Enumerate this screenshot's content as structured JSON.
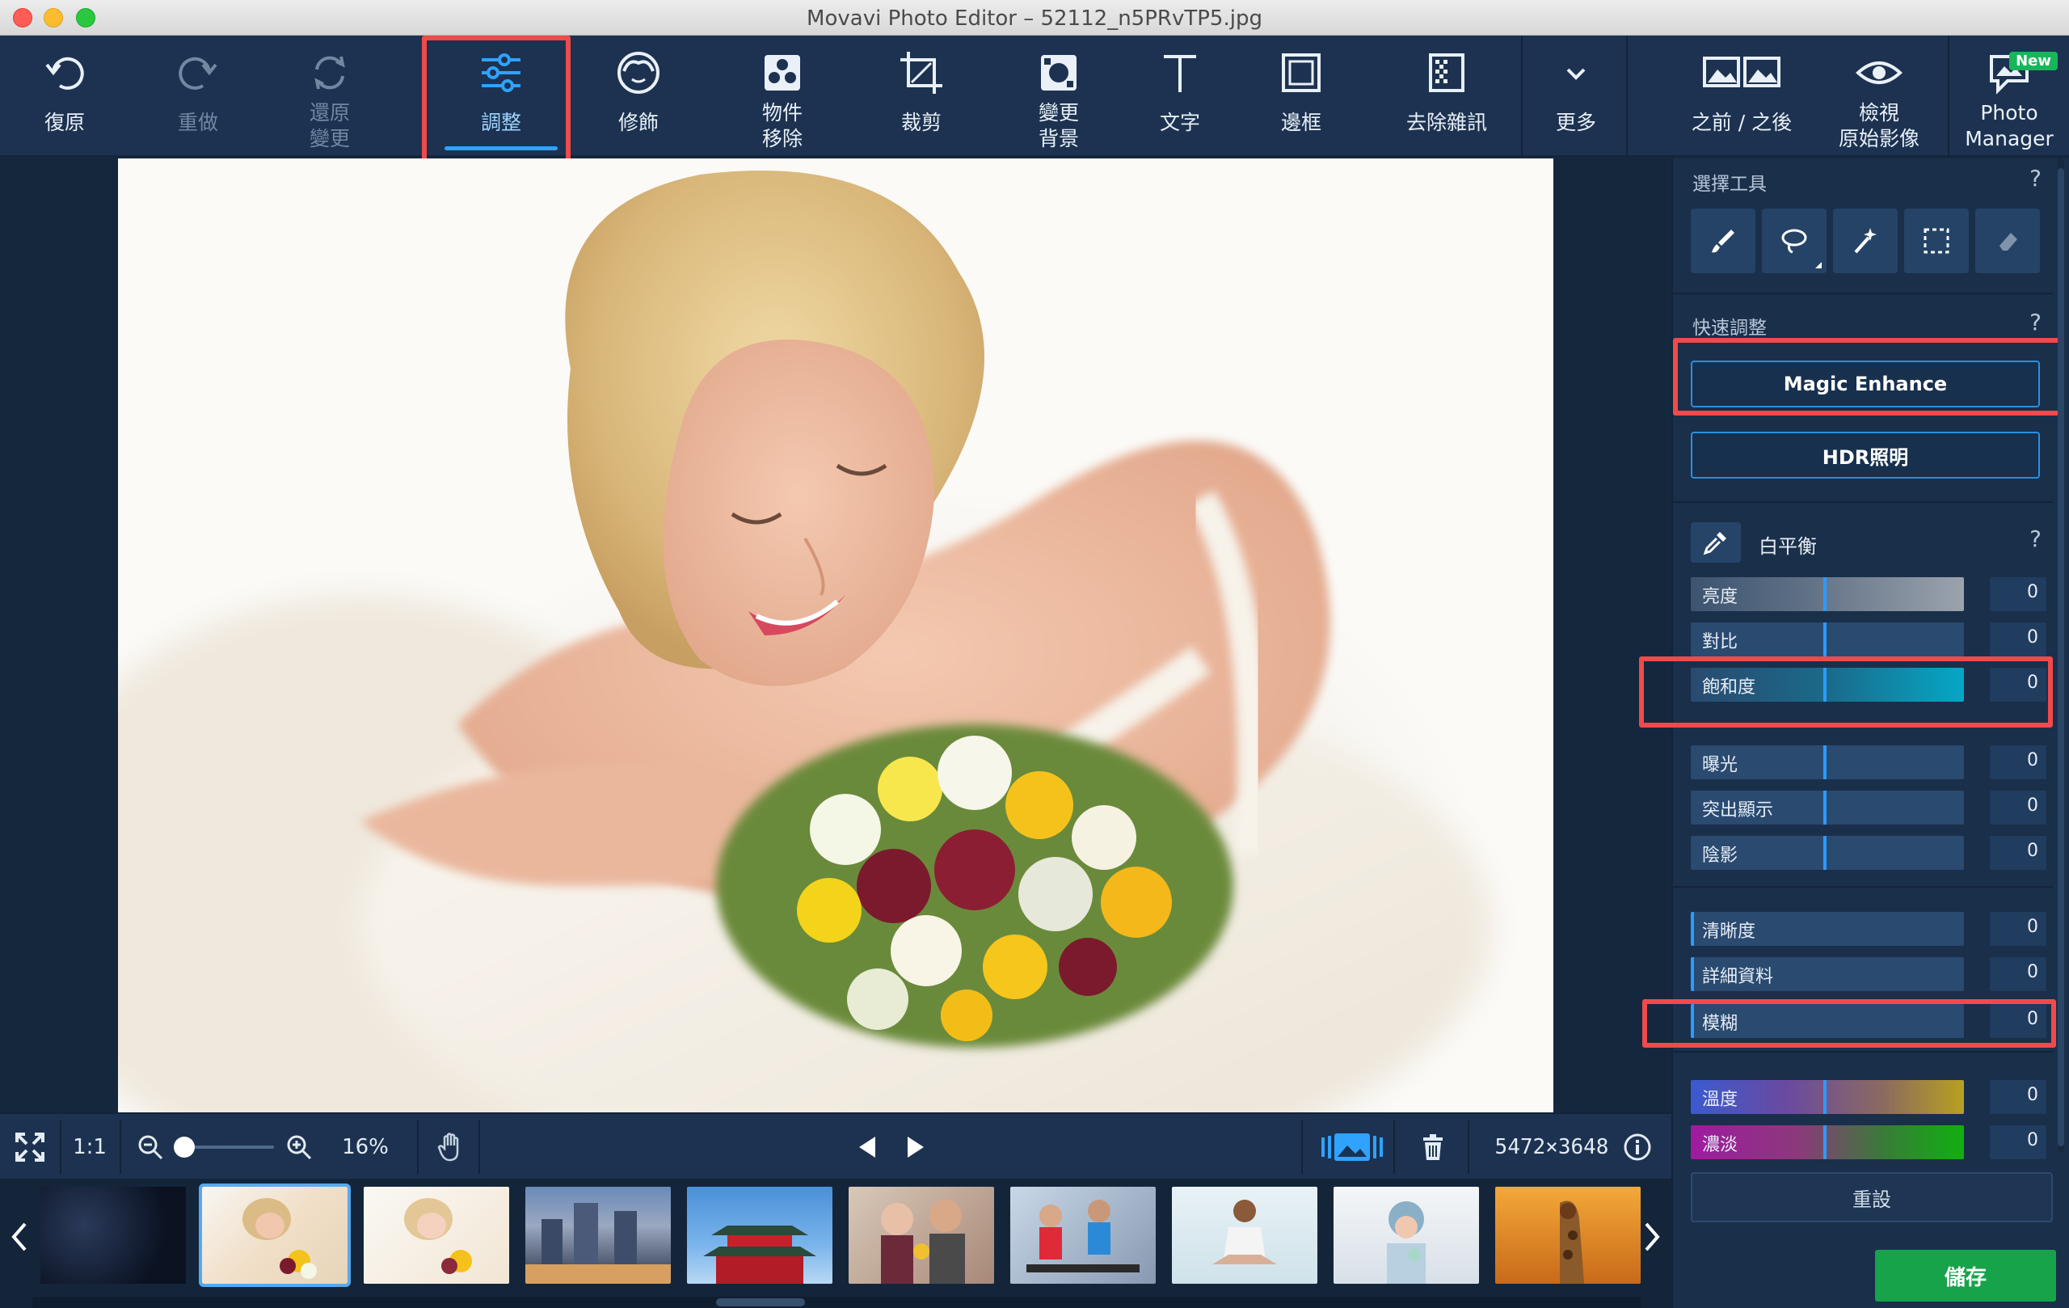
{
  "window": {
    "title": "Movavi Photo Editor – 52112_n5PRvTP5.jpg"
  },
  "toolbar": {
    "undo": "復原",
    "redo": "重做",
    "revert": "還原\n變更",
    "adjust": "調整",
    "retouch": "修飾",
    "object_removal": "物件\n移除",
    "crop": "裁剪",
    "change_background": "變更\n背景",
    "text": "文字",
    "frames": "邊框",
    "denoise": "去除雜訊",
    "more": "更多",
    "before_after": "之前 / 之後",
    "view_original": "檢視\n原始影像",
    "photo_manager": "Photo\nManager",
    "new_badge": "New",
    "accent_color": "#2fa3ff",
    "highlight_color": "#f04a4a"
  },
  "bottombar": {
    "one_to_one": "1:1",
    "zoom_percent": "16%",
    "zoom_slider_level": 0.0,
    "dimensions": "5472×3648"
  },
  "panel": {
    "selection_tools_title": "選擇工具",
    "selection_tools": [
      "brush-icon",
      "lasso-icon",
      "magic-wand-icon",
      "rectangle-select-icon",
      "eraser-icon"
    ],
    "quick_adjust_title": "快速調整",
    "magic_enhance": "Magic Enhance",
    "hdr": "HDR照明",
    "white_balance": "白平衡",
    "help": "?",
    "group1": [
      {
        "label": "亮度",
        "value": "0"
      },
      {
        "label": "對比",
        "value": "0"
      },
      {
        "label": "飽和度",
        "value": "0"
      }
    ],
    "group2": [
      {
        "label": "曝光",
        "value": "0"
      },
      {
        "label": "突出顯示",
        "value": "0"
      },
      {
        "label": "陰影",
        "value": "0"
      }
    ],
    "group3": [
      {
        "label": "清晰度",
        "value": "0"
      },
      {
        "label": "詳細資料",
        "value": "0"
      },
      {
        "label": "模糊",
        "value": "0"
      }
    ],
    "group4": [
      {
        "label": "溫度",
        "value": "0"
      },
      {
        "label": "濃淡",
        "value": "0"
      }
    ],
    "reset": "重設",
    "save": "儲存",
    "save_color": "#16a34a"
  }
}
